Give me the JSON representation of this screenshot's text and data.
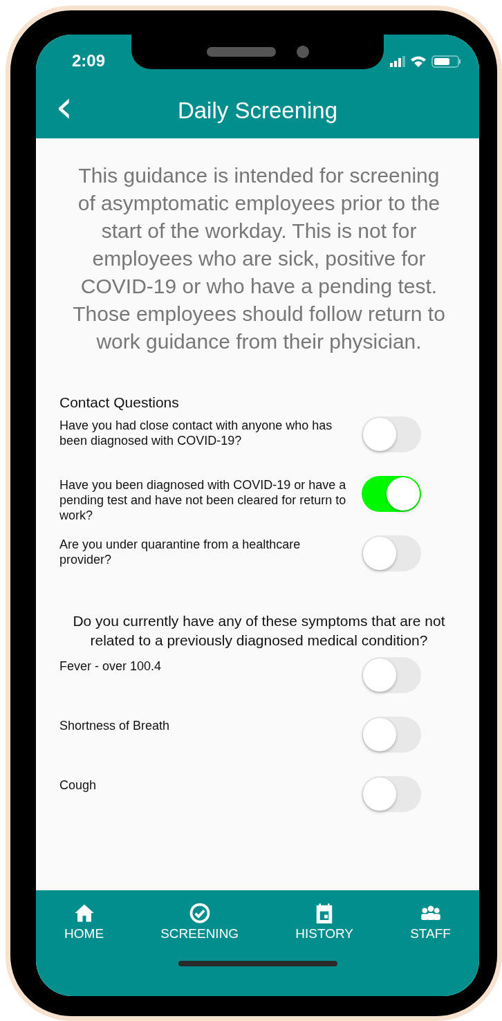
{
  "status_bar": {
    "time": "2:09"
  },
  "header": {
    "back": "‹",
    "title": "Daily Screening"
  },
  "guidance": "This guidance is intended for screening of asymptomatic employees prior to the start of the workday. This is not for employees who are sick, positive for COVID-19 or who have a pending test. Those employees should follow return to work guidance from their physician.",
  "contact_section": {
    "title": "Contact Questions",
    "questions": [
      {
        "text": "Have you had close contact with anyone who has been diagnosed with COVID-19?",
        "on": false
      },
      {
        "text": "Have you been diagnosed with COVID-19 or have a pending test and have not been cleared for return to work?",
        "on": true
      },
      {
        "text": "Are you under quarantine from a healthcare provider?",
        "on": false
      }
    ]
  },
  "symptoms_section": {
    "title": "Do you currently have any of these symptoms that are not related to a previously diagnosed medical condition?",
    "questions": [
      {
        "text": "Fever - over 100.4",
        "on": false
      },
      {
        "text": "Shortness of Breath",
        "on": false
      },
      {
        "text": "Cough",
        "on": false
      }
    ]
  },
  "tab_bar": [
    {
      "kind": "home",
      "label": "HOME"
    },
    {
      "kind": "check",
      "label": "SCREENING"
    },
    {
      "kind": "calendar",
      "label": "HISTORY"
    },
    {
      "kind": "people",
      "label": "STAFF"
    }
  ]
}
